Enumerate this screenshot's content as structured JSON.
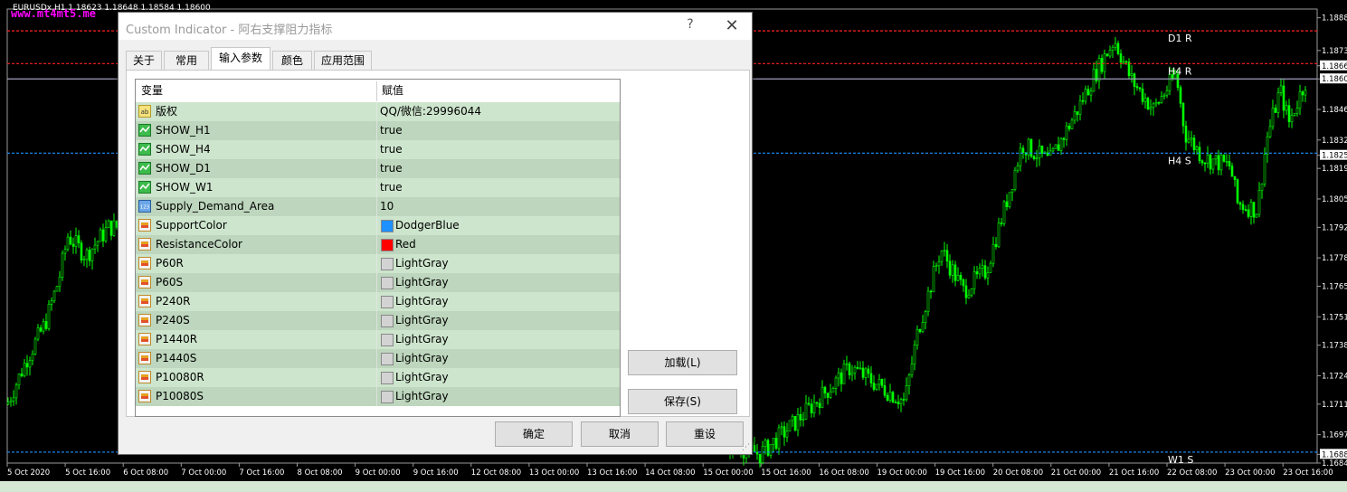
{
  "chart": {
    "symbol_label": "EURUSDx,H1  1.18623 1.18648 1.18584 1.18600",
    "watermark": "www.mt4mt5.me",
    "price_labels": [
      "1.18880",
      "1.18730",
      "1.18660",
      "1.18600",
      "1.18460",
      "1.18320",
      "1.18250",
      "1.18190",
      "1.18050",
      "1.17920",
      "1.17780",
      "1.17650",
      "1.17510",
      "1.17380",
      "1.17240",
      "1.17110",
      "1.16970",
      "1.16880",
      "1.16840"
    ],
    "price_ticks": [
      1.1888,
      1.1873,
      1.1866,
      1.186,
      1.1846,
      1.1832,
      1.1825,
      1.1819,
      1.1805,
      1.1792,
      1.1778,
      1.1765,
      1.1751,
      1.1738,
      1.1724,
      1.1711,
      1.1697,
      1.1688,
      1.1684
    ],
    "time_labels": [
      "5 Oct 2020",
      "5 Oct 16:00",
      "6 Oct 08:00",
      "7 Oct 00:00",
      "7 Oct 16:00",
      "8 Oct 08:00",
      "9 Oct 00:00",
      "9 Oct 16:00",
      "12 Oct 08:00",
      "13 Oct 00:00",
      "13 Oct 16:00",
      "14 Oct 08:00",
      "15 Oct 00:00",
      "15 Oct 16:00",
      "16 Oct 08:00",
      "19 Oct 00:00",
      "19 Oct 16:00",
      "20 Oct 08:00",
      "21 Oct 00:00",
      "21 Oct 16:00",
      "22 Oct 08:00",
      "23 Oct 00:00",
      "23 Oct 16:00"
    ],
    "level_labels": [
      "D1 R",
      "H4 R",
      "H4 S",
      "W1 S"
    ],
    "levels": {
      "d1_r": 1.1882,
      "h4_r": 1.1867,
      "current": 1.186,
      "h4_s": 1.1826,
      "w1_s": 1.1689
    },
    "colors": {
      "bull": "#00ff00",
      "level_red": "#ff2020",
      "level_blue": "#1e90ff",
      "axis": "#ffffff",
      "watermark": "#ff00ff",
      "price_box": "#ffffff"
    }
  },
  "dialog": {
    "title": "Custom Indicator - 阿右支撑阻力指标",
    "help_glyph": "?",
    "close_glyph": "✕",
    "tabs": [
      "关于",
      "常用",
      "输入参数",
      "颜色",
      "应用范围"
    ],
    "active_tab_index": 2,
    "columns": [
      "变量",
      "赋值"
    ],
    "rows": [
      {
        "icon": "ab",
        "name": "版权",
        "value": "QQ/微信:29996044"
      },
      {
        "icon": "bool",
        "name": "SHOW_H1",
        "value": "true"
      },
      {
        "icon": "bool",
        "name": "SHOW_H4",
        "value": "true"
      },
      {
        "icon": "bool",
        "name": "SHOW_D1",
        "value": "true"
      },
      {
        "icon": "bool",
        "name": "SHOW_W1",
        "value": "true"
      },
      {
        "icon": "int",
        "name": "Supply_Demand_Area",
        "value": "10"
      },
      {
        "icon": "color",
        "name": "SupportColor",
        "value": "DodgerBlue",
        "swatch": "#1e90ff"
      },
      {
        "icon": "color",
        "name": "ResistanceColor",
        "value": "Red",
        "swatch": "#ff0000"
      },
      {
        "icon": "color",
        "name": "P60R",
        "value": "LightGray",
        "swatch": "#d3d3d3"
      },
      {
        "icon": "color",
        "name": "P60S",
        "value": "LightGray",
        "swatch": "#d3d3d3"
      },
      {
        "icon": "color",
        "name": "P240R",
        "value": "LightGray",
        "swatch": "#d3d3d3"
      },
      {
        "icon": "color",
        "name": "P240S",
        "value": "LightGray",
        "swatch": "#d3d3d3"
      },
      {
        "icon": "color",
        "name": "P1440R",
        "value": "LightGray",
        "swatch": "#d3d3d3"
      },
      {
        "icon": "color",
        "name": "P1440S",
        "value": "LightGray",
        "swatch": "#d3d3d3"
      },
      {
        "icon": "color",
        "name": "P10080R",
        "value": "LightGray",
        "swatch": "#d3d3d3"
      },
      {
        "icon": "color",
        "name": "P10080S",
        "value": "LightGray",
        "swatch": "#d3d3d3"
      }
    ],
    "buttons": {
      "load": "加载(L)",
      "save": "保存(S)",
      "ok": "确定",
      "cancel": "取消",
      "reset": "重设"
    }
  }
}
